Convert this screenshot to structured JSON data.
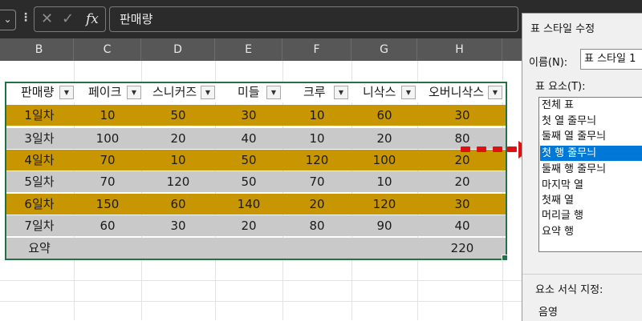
{
  "formula_bar": {
    "fx_label": "fx",
    "formula": "판매량"
  },
  "columns": [
    "B",
    "C",
    "D",
    "E",
    "F",
    "G",
    "H"
  ],
  "table": {
    "headers": [
      "판매량",
      "페이크",
      "스니커즈",
      "미들",
      "크루",
      "니삭스",
      "오버니삭스"
    ],
    "rows": [
      [
        "1일차",
        "10",
        "50",
        "30",
        "10",
        "60",
        "30"
      ],
      [
        "3일차",
        "100",
        "20",
        "40",
        "10",
        "20",
        "80"
      ],
      [
        "4일차",
        "70",
        "10",
        "50",
        "120",
        "100",
        "20"
      ],
      [
        "5일차",
        "70",
        "120",
        "50",
        "70",
        "10",
        "20"
      ],
      [
        "6일차",
        "150",
        "60",
        "140",
        "20",
        "120",
        "30"
      ],
      [
        "7일차",
        "60",
        "30",
        "20",
        "80",
        "90",
        "40"
      ],
      [
        "요약",
        "",
        "",
        "",
        "",
        "",
        "220"
      ]
    ],
    "row_styles": [
      "gold",
      "gray",
      "gold",
      "gray",
      "gold",
      "gray",
      "gray"
    ],
    "colors": {
      "gold": "#c89600",
      "gray": "#c9c9c9",
      "selection": "#217346"
    }
  },
  "dialog": {
    "title": "표 스타일 수정",
    "name_label": "이름(N):",
    "name_value": "표 스타일 1",
    "elements_label": "표 요소(T):",
    "elements": [
      "전체 표",
      "첫 열 줄무늬",
      "둘째 열 줄무늬",
      "첫 행 줄무늬",
      "둘째 행 줄무늬",
      "마지막 열",
      "첫째 열",
      "머리글 행",
      "요약 행"
    ],
    "selected_index": 3,
    "format_label": "요소 서식 지정:",
    "format_value": "음영"
  },
  "arrow_color": "#e01010"
}
